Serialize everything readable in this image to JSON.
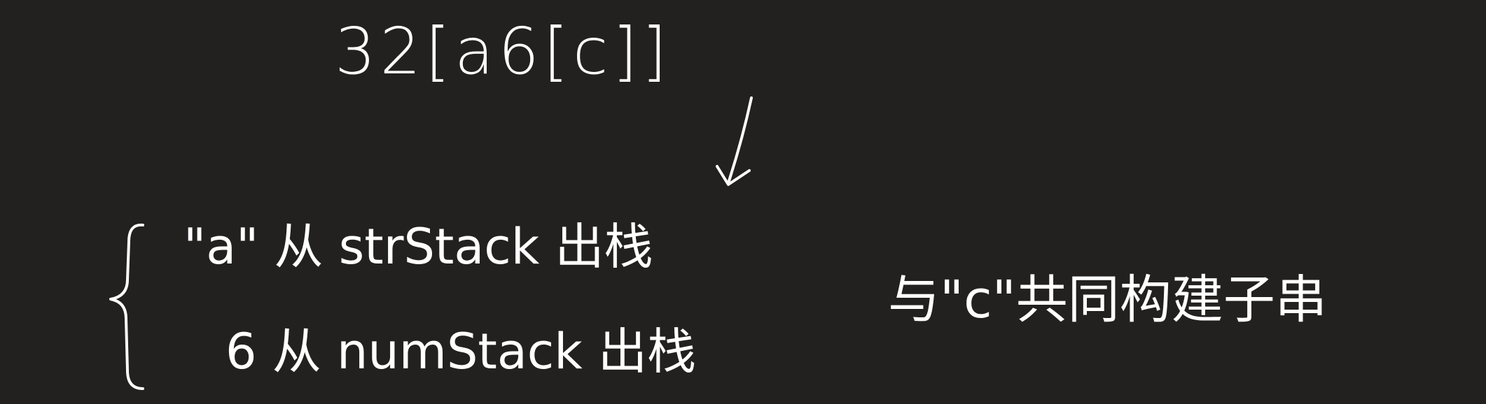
{
  "expression": "32[a6[c]]",
  "steps": [
    "\"a\" 从 strStack 出栈",
    "6 从 numStack 出栈"
  ],
  "note": "与\"c\"共同构建子串",
  "colors": {
    "background": "#222120",
    "ink": "#ffffff"
  },
  "icons": {
    "arrow": "arrow-down-icon",
    "brace": "left-curly-brace"
  }
}
